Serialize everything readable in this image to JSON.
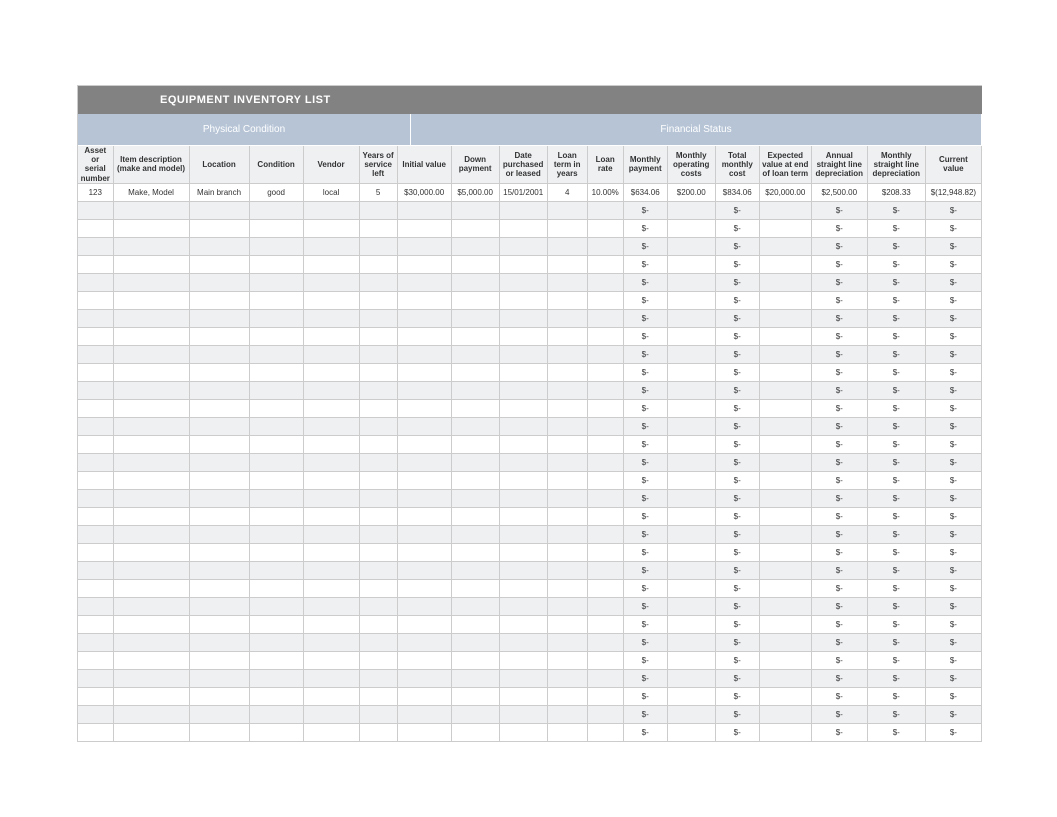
{
  "title": "EQUIPMENT INVENTORY LIST",
  "sections": {
    "physical": "Physical Condition",
    "financial": "Financial Status"
  },
  "columns": [
    "Asset or serial number",
    "Item description (make and model)",
    "Location",
    "Condition",
    "Vendor",
    "Years of service left",
    "Initial value",
    "Down payment",
    "Date purchased or leased",
    "Loan term in years",
    "Loan rate",
    "Monthly payment",
    "Monthly operating costs",
    "Total monthly cost",
    "Expected value at end of loan term",
    "Annual straight line depreciation",
    "Monthly straight line depreciation",
    "Current value"
  ],
  "first_row": [
    "123",
    "Make, Model",
    "Main branch",
    "good",
    "local",
    "5",
    "$30,000.00",
    "$5,000.00",
    "15/01/2001",
    "4",
    "10.00%",
    "$634.06",
    "$200.00",
    "$834.06",
    "$20,000.00",
    "$2,500.00",
    "$208.33",
    "$(12,948.82)"
  ],
  "empty_row": [
    "",
    "",
    "",
    "",
    "",
    "",
    "",
    "",
    "",
    "",
    "",
    "$-",
    "",
    "$-",
    "",
    "$-",
    "$-",
    "$-"
  ],
  "empty_row_count": 30
}
